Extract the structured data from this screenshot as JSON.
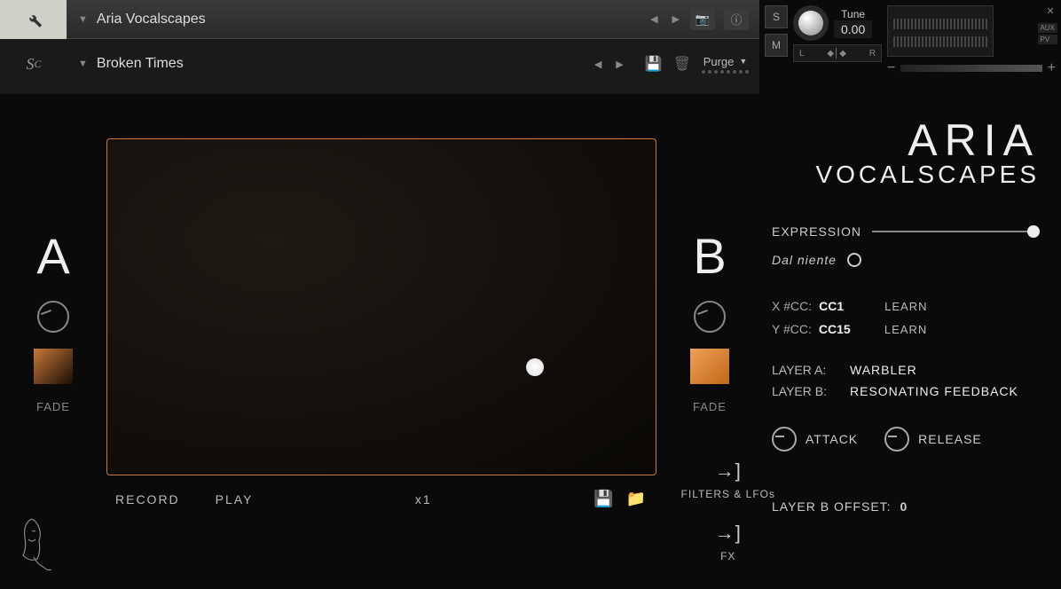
{
  "header": {
    "instrument": "Aria Vocalscapes",
    "preset": "Broken Times",
    "purge": "Purge"
  },
  "tune": {
    "label": "Tune",
    "value": "0.00",
    "left": "L",
    "right": "R"
  },
  "side_buttons": {
    "s": "S",
    "m": "M",
    "aux": "AUX",
    "pv": "PV"
  },
  "layers": {
    "a": {
      "letter": "A",
      "fade": "FADE"
    },
    "b": {
      "letter": "B",
      "fade": "FADE"
    }
  },
  "transport": {
    "record": "RECORD",
    "play": "PLAY",
    "speed": "x1"
  },
  "sections": {
    "filters": "FILTERS & LFOs",
    "fx": "FX"
  },
  "brand": {
    "line1": "ARIA",
    "line2": "VOCALSCAPES"
  },
  "params": {
    "expression": "EXPRESSION",
    "dal_niente": "Dal niente",
    "x_cc_label": "X #CC:",
    "x_cc_val": "CC1",
    "y_cc_label": "Y #CC:",
    "y_cc_val": "CC15",
    "learn": "LEARN",
    "layer_a_label": "LAYER A:",
    "layer_a_val": "WARBLER",
    "layer_b_label": "LAYER B:",
    "layer_b_val": "RESONATING FEEDBACK",
    "attack": "ATTACK",
    "release": "RELEASE",
    "offset_label": "LAYER B OFFSET:",
    "offset_val": "0"
  }
}
